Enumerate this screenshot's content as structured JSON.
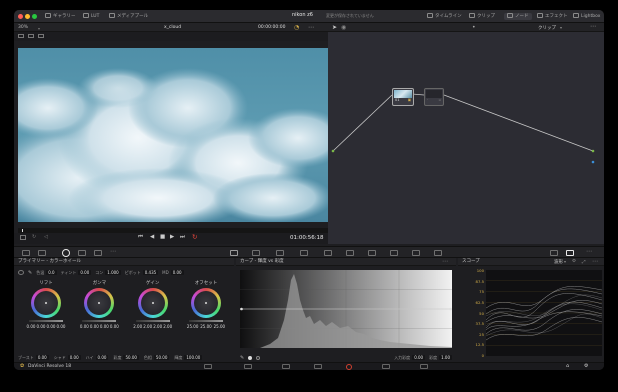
{
  "titlebar": {
    "gallery": "ギャラリー",
    "lut": "LUT",
    "media_pool": "メディアプール",
    "project": "nikon z6",
    "status": "変更が保存されていません",
    "timeline": "タイムライン",
    "clips": "クリップ",
    "nodes": "ノード",
    "effects": "エフェクト",
    "lightbox": "Lightbox"
  },
  "viewer": {
    "zoom": "30%",
    "clip_name": "x_cloud",
    "source_timecode": "00:00:00:00",
    "timecode": "01:00:56:18"
  },
  "node_editor": {
    "clip_mode": "クリップ",
    "node1_label": "01"
  },
  "primaries": {
    "title": "プライマリー - カラーホイール",
    "temp_label": "色温",
    "temp_value": "0.0",
    "tint_label": "ティント",
    "tint_value": "0.00",
    "contrast_label": "コン",
    "contrast_value": "1.000",
    "pivot_label": "ピボット",
    "pivot_value": "0.435",
    "md_label": "MD",
    "md_value": "0.00",
    "wheels": [
      {
        "name": "リフト",
        "values": [
          "0.00",
          "0.00",
          "0.00",
          "0.00"
        ]
      },
      {
        "name": "ガンマ",
        "values": [
          "0.00",
          "0.00",
          "0.00",
          "0.00"
        ]
      },
      {
        "name": "ゲイン",
        "values": [
          "2.00",
          "2.00",
          "2.00",
          "2.00"
        ]
      },
      {
        "name": "オフセット",
        "values": [
          "25.00",
          "25.00",
          "25.00",
          ""
        ]
      }
    ],
    "footer": {
      "boost_label": "ブースト",
      "boost_value": "0.00",
      "shad_label": "シャド",
      "shad_value": "0.00",
      "hl_label": "ハイ",
      "hl_value": "0.00",
      "sat_label": "彩度",
      "sat_value": "50.00",
      "hue_label": "色相",
      "hue_value": "50.00",
      "lum_label": "輝度",
      "lum_value": "100.00"
    }
  },
  "curves": {
    "title": "カーブ - 輝度 vs 彩度",
    "input_sat_label": "入力彩度",
    "input_sat_value": "0.00",
    "sat_label": "彩度",
    "sat_value": "1.00"
  },
  "scopes": {
    "title": "スコープ",
    "mode": "波形",
    "ticks": [
      "100",
      "87.5",
      "75",
      "62.5",
      "50",
      "37.5",
      "25",
      "12.5",
      "0"
    ]
  },
  "bottom": {
    "app_name": "DaVinci Resolve 18"
  },
  "colors": {
    "accent_red": "#e0443a",
    "active_page": "#d24030"
  }
}
